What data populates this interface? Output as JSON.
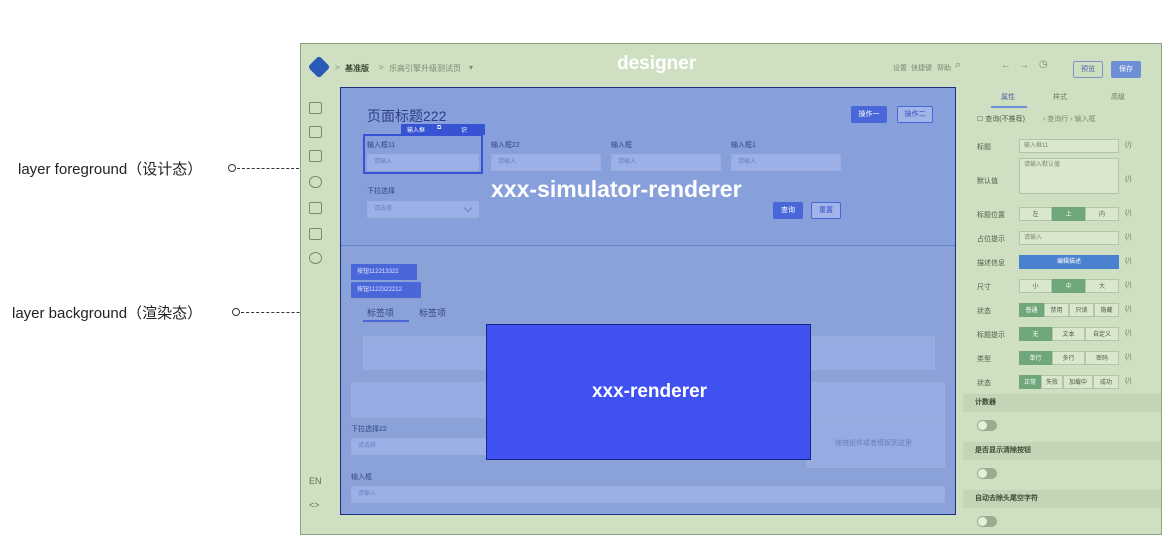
{
  "annotations": {
    "foreground": "layer foreground（设计态）",
    "background": "layer background（渲染态）"
  },
  "designer": {
    "title": "designer",
    "breadcrumb": [
      "基准版",
      "乐高引擎升级测试页"
    ],
    "toolbar": {
      "items": [
        "设置",
        "快捷键",
        "帮助"
      ],
      "preview_label": "预览",
      "save_label": "保存"
    },
    "sidebar_footer": [
      "EN",
      "<>"
    ]
  },
  "panel": {
    "tabs": [
      "属性",
      "样式",
      "高级"
    ],
    "checkbox_label": "查询(不推荐)",
    "crumb": [
      "查询行",
      "输入框"
    ],
    "rows": {
      "title_label": "标题",
      "title_value": "输入框11",
      "default_label": "默认值",
      "default_placeholder": "请输入默认值",
      "label_pos_label": "标题位置",
      "label_pos_options": [
        "左",
        "上",
        "内"
      ],
      "placeholder_label": "占位提示",
      "placeholder_value": "请输入",
      "desc_label": "描述信息",
      "desc_button": "编辑描述",
      "size_label": "尺寸",
      "size_options": [
        "小",
        "中",
        "大"
      ],
      "state_label": "状态",
      "state_options": [
        "普通",
        "禁用",
        "只读",
        "隐藏"
      ],
      "hint_label": "标题提示",
      "hint_options": [
        "无",
        "文本",
        "自定义"
      ],
      "type_label": "类型",
      "type_options": [
        "单行",
        "多行",
        "密码"
      ],
      "status_label": "状态",
      "status_options": [
        "正常",
        "失败",
        "加载中",
        "成功"
      ],
      "fx": "(/)"
    },
    "sections": [
      "计数器",
      "是否显示清除按钮",
      "自动去除头尾空字符"
    ]
  },
  "simulator": {
    "label": "xxx-simulator-renderer",
    "page_title": "页面标题222",
    "action_buttons": [
      "操作一",
      "操作二"
    ],
    "field_toolbar": [
      "输入框",
      "识"
    ],
    "fields": [
      {
        "label": "输入框11",
        "placeholder": "请输入"
      },
      {
        "label": "输入框22",
        "placeholder": "请输入"
      },
      {
        "label": "输入框",
        "placeholder": "请输入"
      },
      {
        "label": "输入框1",
        "placeholder": "请输入"
      }
    ],
    "select_label": "下拉选择",
    "select_placeholder": "请选择",
    "query_button": "查询",
    "reset_button": "重置",
    "tags": [
      "按钮112213322",
      "按钮1122322212"
    ],
    "tabs": [
      "标签项",
      "标签项"
    ],
    "select22_label": "下拉选择22",
    "select22_placeholder": "请选择",
    "drop_hint": "拖拽组件或者模板到这里",
    "bottom_input_label": "输入框",
    "bottom_input_placeholder": "请输入"
  },
  "renderer": {
    "label": "xxx-renderer"
  }
}
